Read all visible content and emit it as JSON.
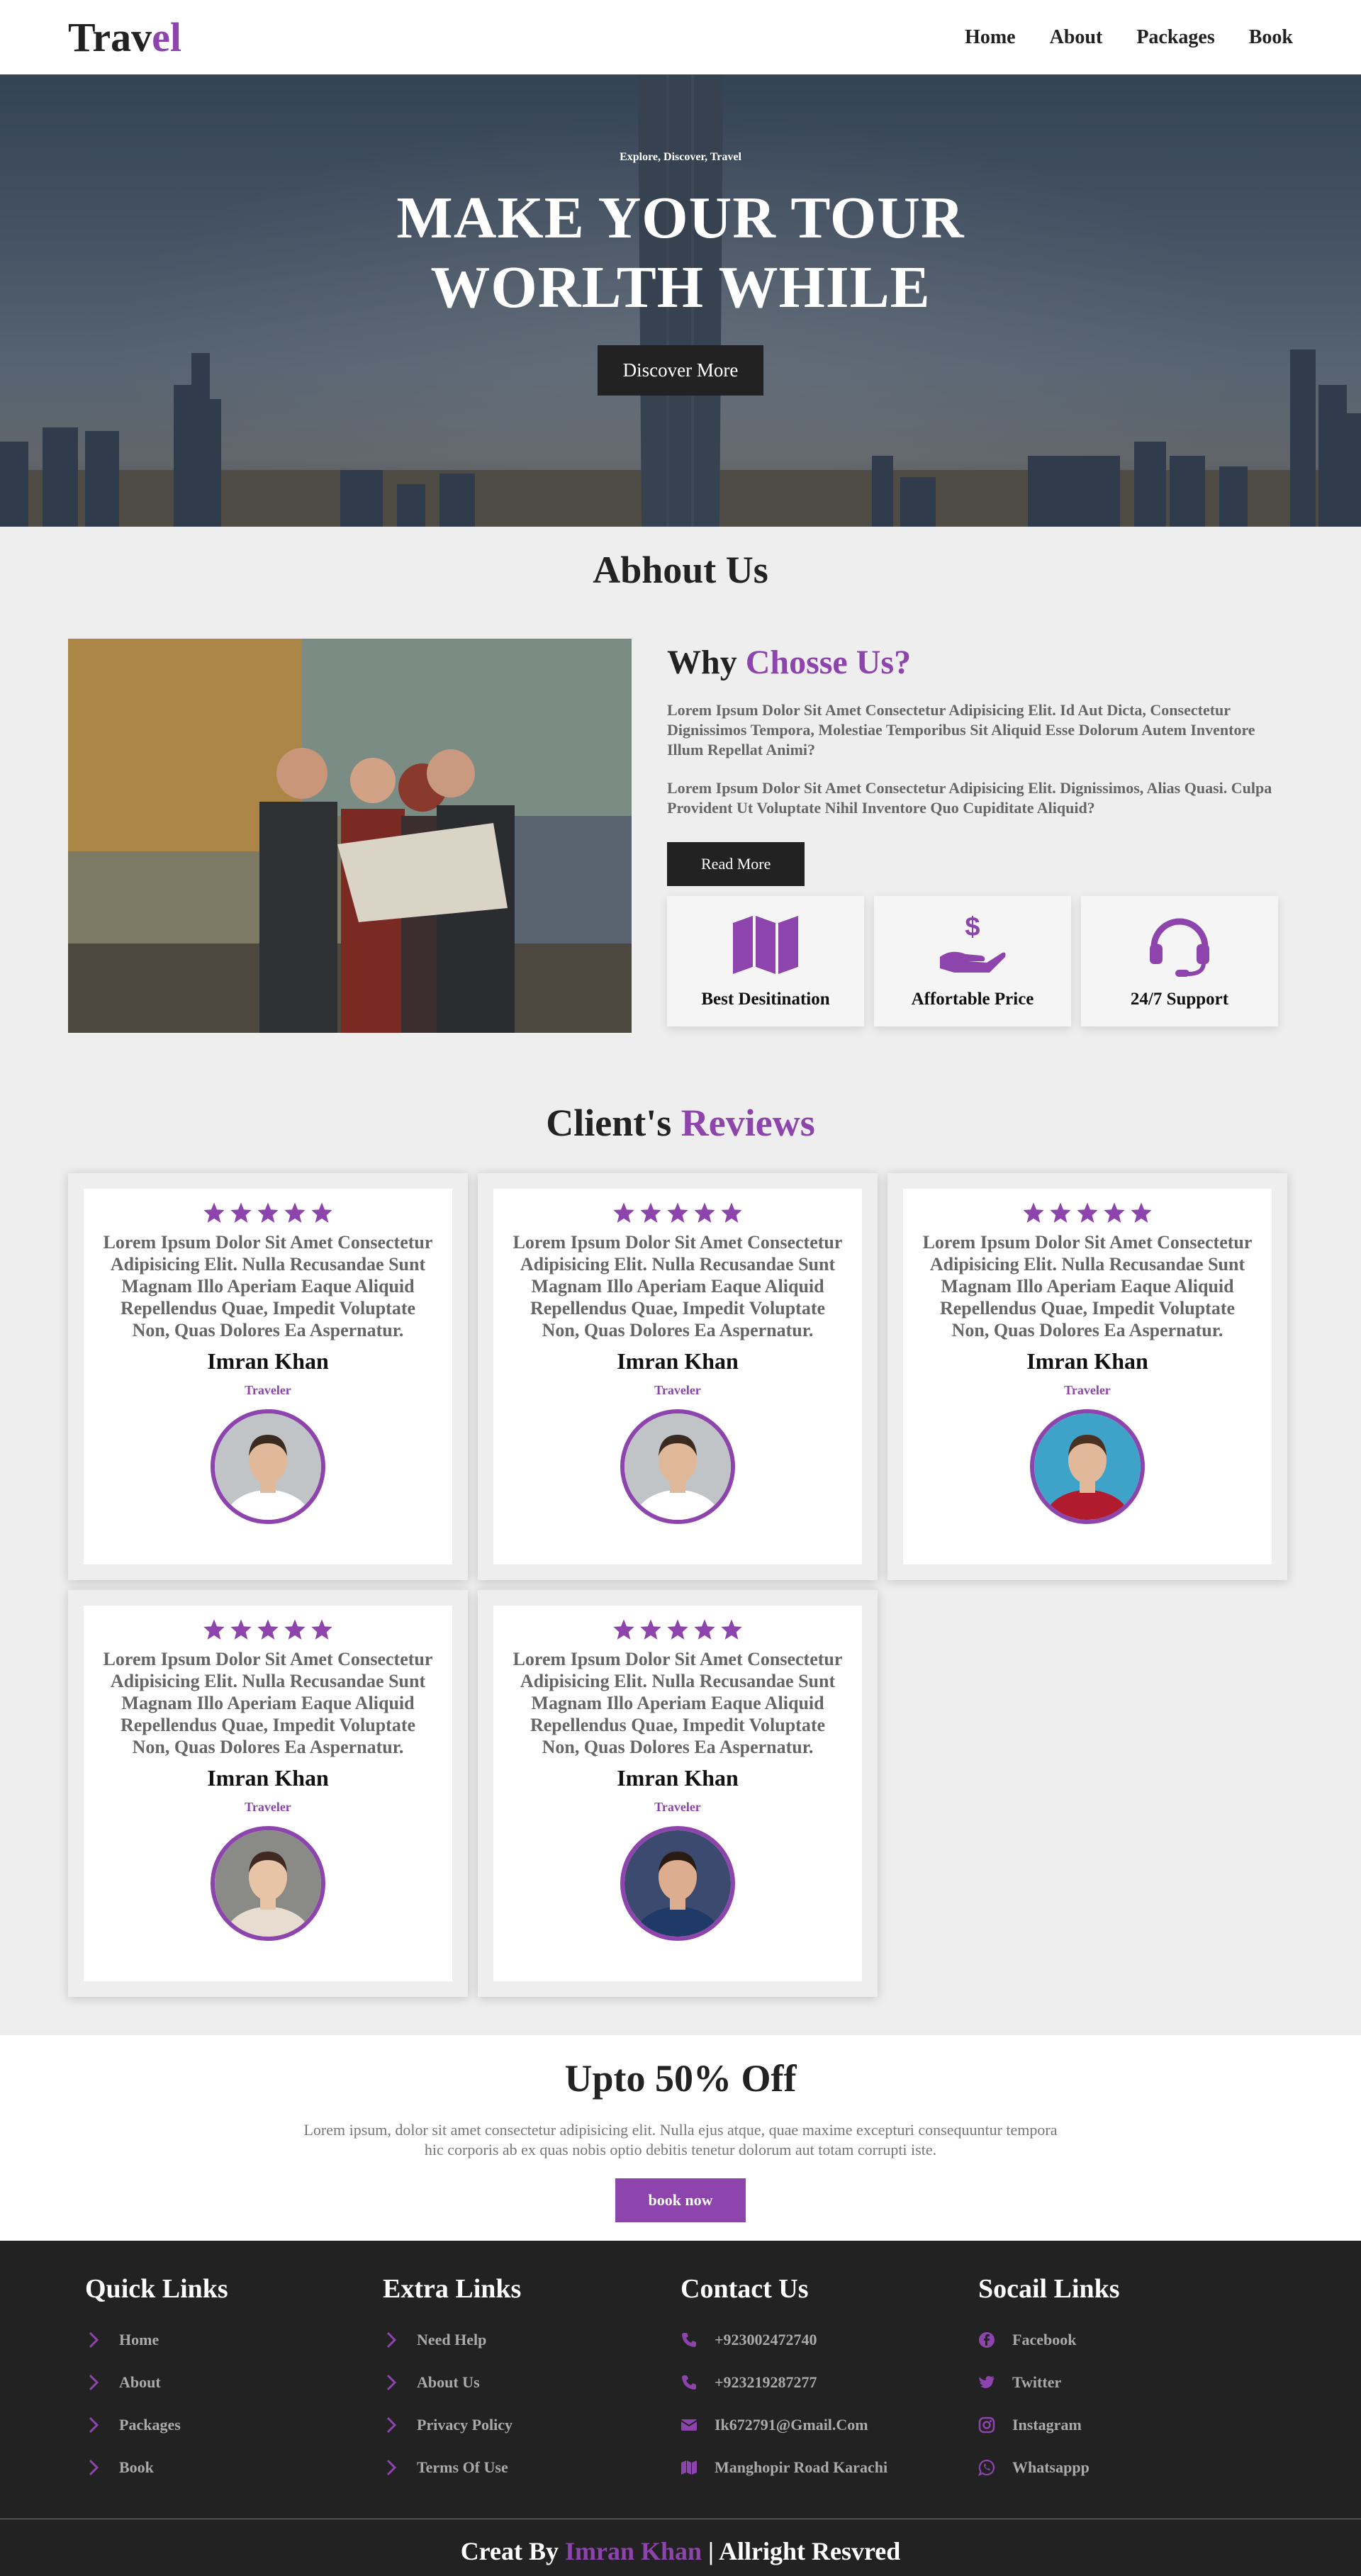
{
  "colors": {
    "accent": "#8e44ad",
    "dark": "#222222",
    "background": "#eeeeee"
  },
  "header": {
    "logo_main": "Trav",
    "logo_accent": "el",
    "nav": [
      "Home",
      "About",
      "Packages",
      "Book"
    ]
  },
  "hero": {
    "kicker": "Explore, Discover, Travel",
    "title_line1": "MAKE YOUR TOUR",
    "title_line2": "WORLTH WHILE",
    "button": "Discover More"
  },
  "about": {
    "title": "Abhout Us",
    "heading_main": "Why",
    "heading_accent": "Chosse Us?",
    "para1": "Lorem Ipsum Dolor Sit Amet Consectetur Adipisicing Elit. Id Aut Dicta, Consectetur Dignissimos Tempora, Molestiae Temporibus Sit Aliquid Esse Dolorum Autem Inventore Illum Repellat Animi?",
    "para2": "Lorem Ipsum Dolor Sit Amet Consectetur Adipisicing Elit. Dignissimos, Alias Quasi. Culpa Provident Ut Voluptate Nihil Inventore Quo Cupiditate Aliquid?",
    "button": "Read More",
    "features": [
      {
        "label": "Best Desitination",
        "icon": "map-icon"
      },
      {
        "label": "Affortable Price",
        "icon": "hand-dollar-icon"
      },
      {
        "label": "24/7 Support",
        "icon": "headset-icon"
      }
    ]
  },
  "reviews": {
    "title_main": "Client's",
    "title_accent": "Reviews",
    "items": [
      {
        "stars": 5,
        "text": "Lorem Ipsum Dolor Sit Amet Consectetur Adipisicing Elit. Nulla Recusandae Sunt Magnam Illo Aperiam Eaque Aliquid Repellendus Quae, Impedit Voluptate Non, Quas Dolores Ea Aspernatur.",
        "name": "Imran Khan",
        "role": "Traveler"
      },
      {
        "stars": 5,
        "text": "Lorem Ipsum Dolor Sit Amet Consectetur Adipisicing Elit. Nulla Recusandae Sunt Magnam Illo Aperiam Eaque Aliquid Repellendus Quae, Impedit Voluptate Non, Quas Dolores Ea Aspernatur.",
        "name": "Imran Khan",
        "role": "Traveler"
      },
      {
        "stars": 5,
        "text": "Lorem Ipsum Dolor Sit Amet Consectetur Adipisicing Elit. Nulla Recusandae Sunt Magnam Illo Aperiam Eaque Aliquid Repellendus Quae, Impedit Voluptate Non, Quas Dolores Ea Aspernatur.",
        "name": "Imran Khan",
        "role": "Traveler"
      },
      {
        "stars": 5,
        "text": "Lorem Ipsum Dolor Sit Amet Consectetur Adipisicing Elit. Nulla Recusandae Sunt Magnam Illo Aperiam Eaque Aliquid Repellendus Quae, Impedit Voluptate Non, Quas Dolores Ea Aspernatur.",
        "name": "Imran Khan",
        "role": "Traveler"
      },
      {
        "stars": 5,
        "text": "Lorem Ipsum Dolor Sit Amet Consectetur Adipisicing Elit. Nulla Recusandae Sunt Magnam Illo Aperiam Eaque Aliquid Repellendus Quae, Impedit Voluptate Non, Quas Dolores Ea Aspernatur.",
        "name": "Imran Khan",
        "role": "Traveler"
      }
    ]
  },
  "offer": {
    "title": "Upto 50% Off",
    "text": "Lorem ipsum, dolor sit amet consectetur adipisicing elit. Nulla ejus atque, quae maxime excepturi consequuntur tempora hic corporis ab ex quas nobis optio debitis tenetur dolorum aut totam corrupti iste.",
    "button": "book now"
  },
  "footer": {
    "quick": {
      "title": "Quick Links",
      "items": [
        "Home",
        "About",
        "Packages",
        "Book"
      ]
    },
    "extra": {
      "title": "Extra Links",
      "items": [
        "Need Help",
        "About Us",
        "Privacy Policy",
        "Terms Of Use"
      ]
    },
    "contact": {
      "title": "Contact Us",
      "items": [
        {
          "text": "+923002472740",
          "icon": "phone-icon"
        },
        {
          "text": "+923219287277",
          "icon": "phone-icon"
        },
        {
          "text": "Ik672791@Gmail.Com",
          "icon": "envelope-icon"
        },
        {
          "text": "Manghopir Road Karachi",
          "icon": "map-icon"
        }
      ]
    },
    "social": {
      "title": "Socail Links",
      "items": [
        {
          "text": "Facebook",
          "icon": "facebook-icon"
        },
        {
          "text": "Twitter",
          "icon": "twitter-icon"
        },
        {
          "text": "Instagram",
          "icon": "instagram-icon"
        },
        {
          "text": "Whatsappp",
          "icon": "whatsapp-icon"
        }
      ]
    },
    "credit_pre": "Creat By",
    "credit_name": "Imran Khan",
    "credit_post": "| Allright Resvred"
  }
}
